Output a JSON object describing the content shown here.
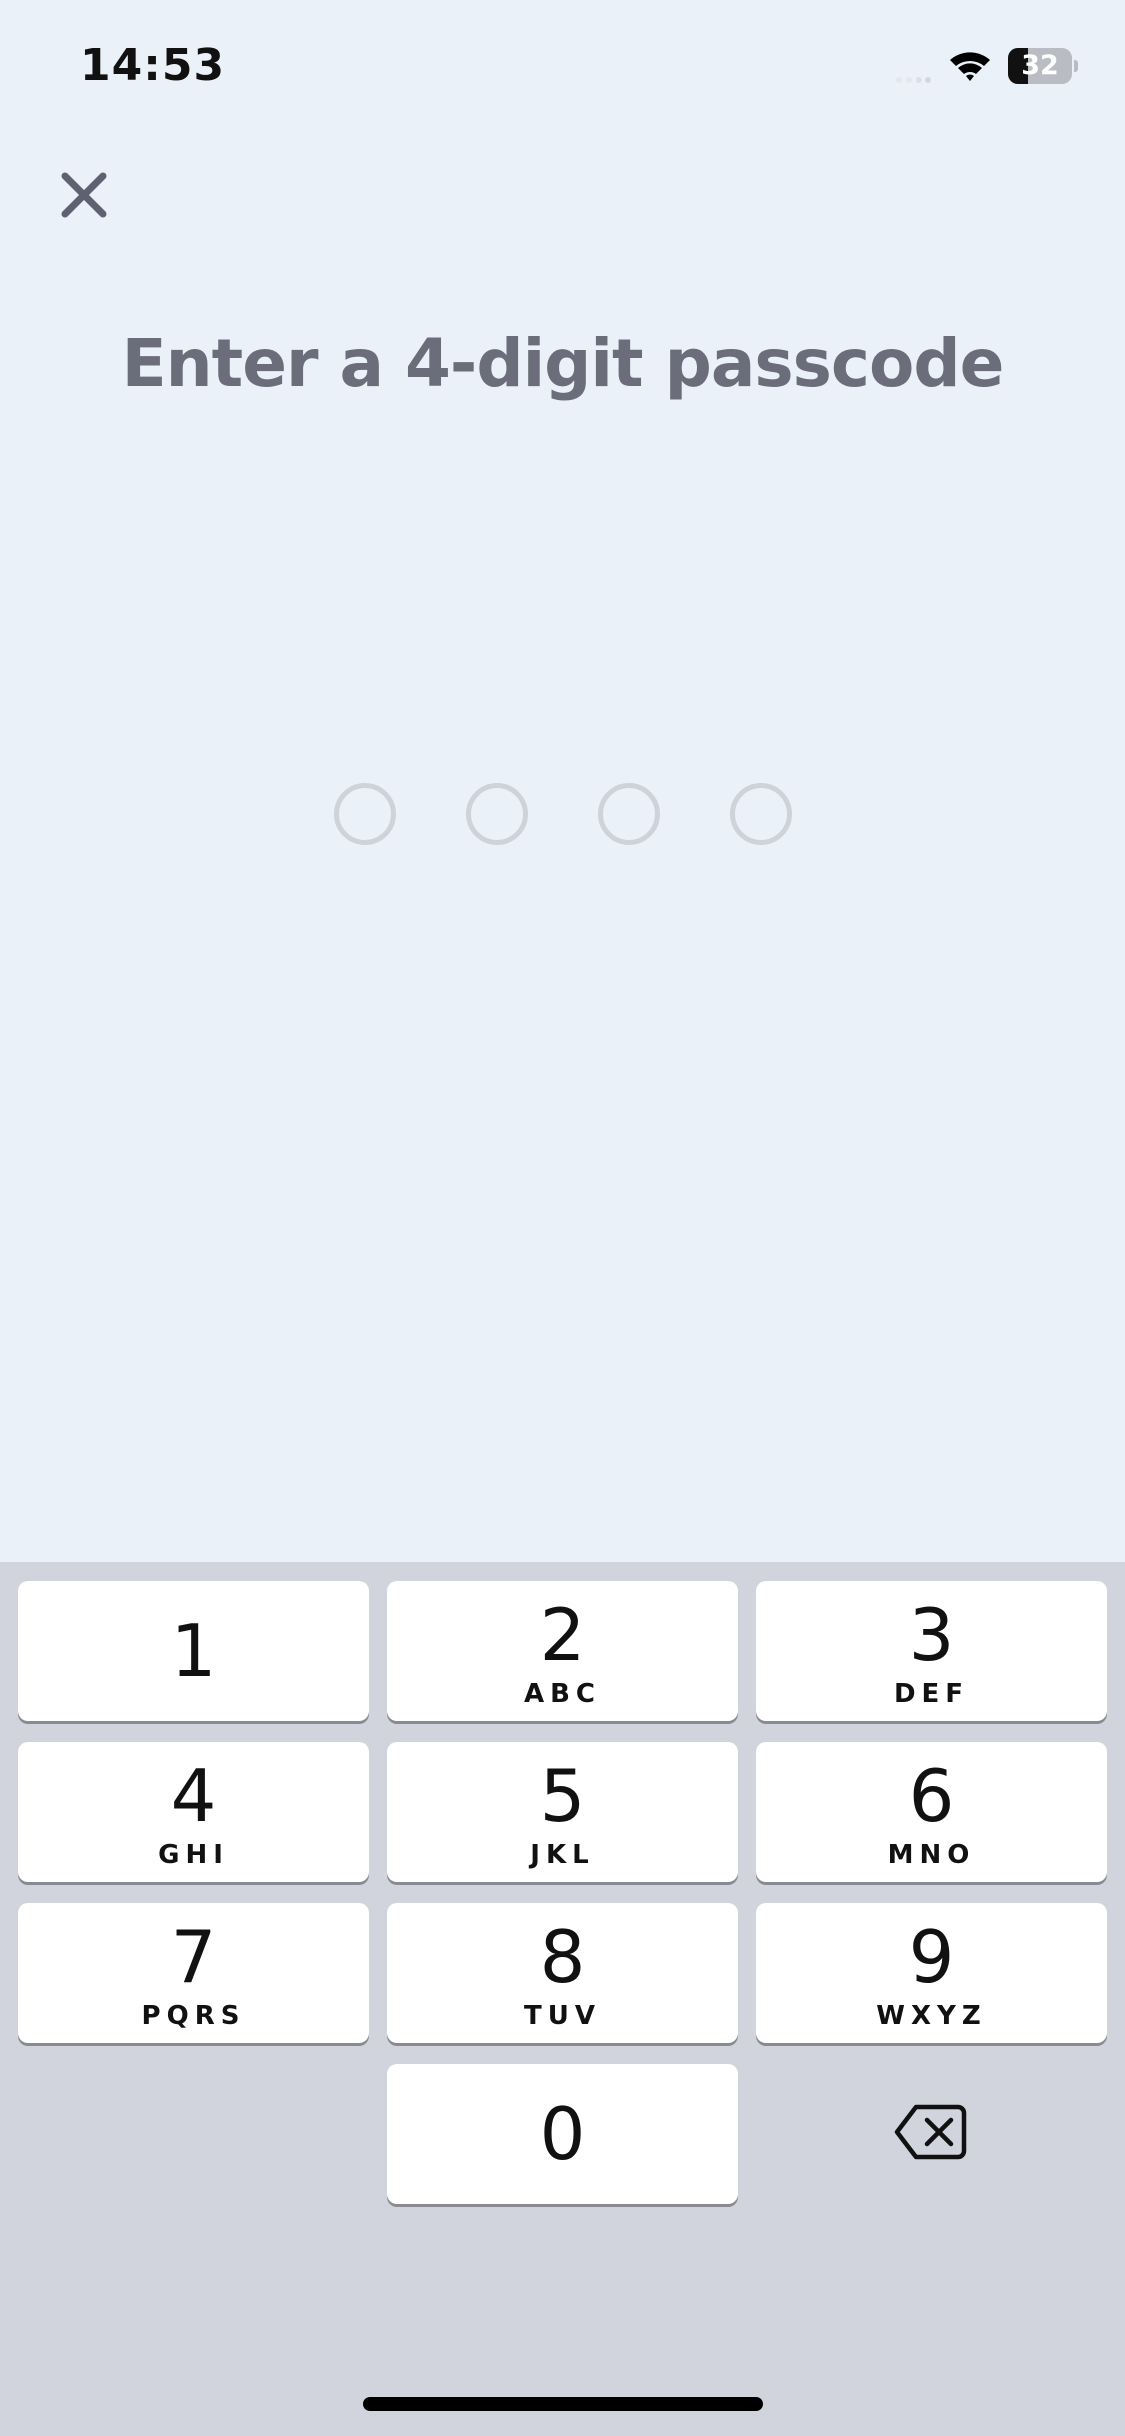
{
  "status_bar": {
    "time": "14:53",
    "battery_level": "32",
    "battery_fraction": 0.32,
    "icons": [
      "signal-icon",
      "wifi-icon",
      "battery-icon"
    ]
  },
  "header": {
    "close_icon": "close-icon",
    "title": "Enter a 4-digit passcode"
  },
  "passcode": {
    "length": 4,
    "entered": 0
  },
  "keypad": {
    "keys": [
      {
        "digit": "1",
        "letters": ""
      },
      {
        "digit": "2",
        "letters": "ABC"
      },
      {
        "digit": "3",
        "letters": "DEF"
      },
      {
        "digit": "4",
        "letters": "GHI"
      },
      {
        "digit": "5",
        "letters": "JKL"
      },
      {
        "digit": "6",
        "letters": "MNO"
      },
      {
        "digit": "7",
        "letters": "PQRS"
      },
      {
        "digit": "8",
        "letters": "TUV"
      },
      {
        "digit": "9",
        "letters": "WXYZ"
      },
      {
        "digit": "0",
        "letters": ""
      }
    ],
    "delete_icon": "backspace-icon"
  },
  "colors": {
    "background": "#ebf1f9",
    "title": "#6b6e7a",
    "dot_border": "#ced2d9",
    "keypad_bg": "#d1d4dc",
    "key_bg": "#ffffff"
  }
}
